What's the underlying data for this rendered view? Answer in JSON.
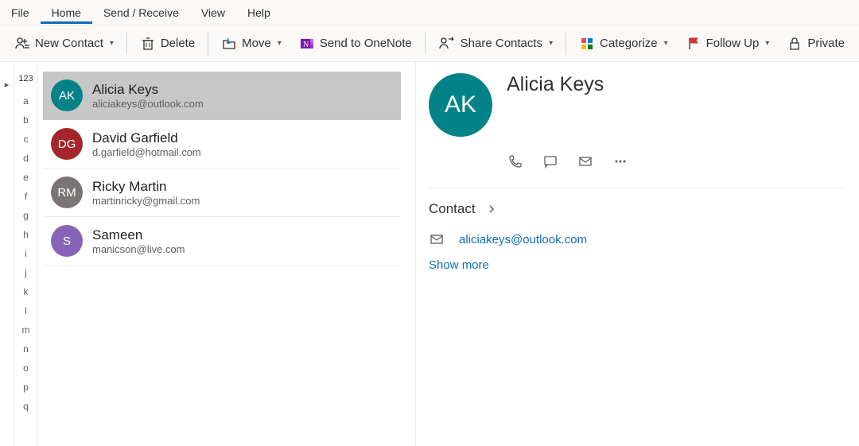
{
  "menu": {
    "file": "File",
    "home": "Home",
    "sendreceive": "Send / Receive",
    "view": "View",
    "help": "Help"
  },
  "toolbar": {
    "new_contact": "New Contact",
    "delete": "Delete",
    "move": "Move",
    "send_onenote": "Send to OneNote",
    "share_contacts": "Share Contacts",
    "categorize": "Categorize",
    "follow_up": "Follow Up",
    "private": "Private"
  },
  "alpha_header": "123",
  "alpha": [
    "a",
    "b",
    "c",
    "d",
    "e",
    "f",
    "g",
    "h",
    "i",
    "j",
    "k",
    "l",
    "m",
    "n",
    "o",
    "p",
    "q"
  ],
  "contacts": [
    {
      "initials": "AK",
      "name": "Alicia Keys",
      "email": "aliciakeys@outlook.com",
      "color": "#038387",
      "selected": true
    },
    {
      "initials": "DG",
      "name": "David Garfield",
      "email": "d.garfield@hotmail.com",
      "color": "#a4262c",
      "selected": false
    },
    {
      "initials": "RM",
      "name": "Ricky Martin",
      "email": "martinricky@gmail.com",
      "color": "#7a7574",
      "selected": false
    },
    {
      "initials": "S",
      "name": "Sameen",
      "email": "manicson@live.com",
      "color": "#8764b8",
      "selected": false
    }
  ],
  "detail": {
    "initials": "AK",
    "name": "Alicia Keys",
    "section_label": "Contact",
    "email": "aliciakeys@outlook.com",
    "show_more": "Show more"
  }
}
